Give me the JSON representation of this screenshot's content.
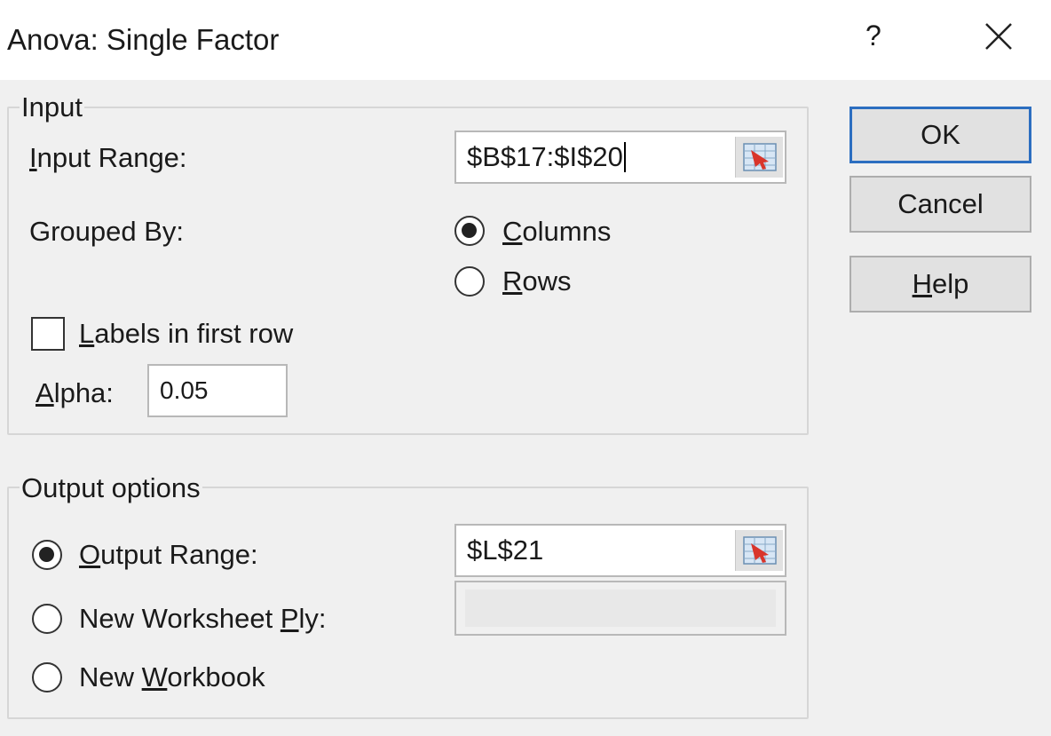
{
  "dialog": {
    "title": "Anova: Single Factor",
    "help_glyph": "?",
    "close_icon": "close-icon"
  },
  "input": {
    "legend": "Input",
    "input_range_label_first": "I",
    "input_range_label_rest": "nput Range:",
    "input_range_value": "$B$17:$I$20",
    "grouped_by_label": "Grouped By:",
    "columns_first": "C",
    "columns_rest": "olumns",
    "rows_first": "R",
    "rows_rest": "ows",
    "grouped_by_selected": "Columns",
    "labels_first": "L",
    "labels_rest": "abels in first row",
    "labels_checked": false,
    "alpha_first": "A",
    "alpha_rest": "lpha:",
    "alpha_value": "0.05"
  },
  "output": {
    "legend": "Output options",
    "output_range_first": "O",
    "output_range_rest": "utput Range:",
    "output_range_value": "$L$21",
    "new_ply_before": "New Worksheet ",
    "new_ply_u": "P",
    "new_ply_after": "ly:",
    "new_workbook_before": "New ",
    "new_workbook_u": "W",
    "new_workbook_after": "orkbook",
    "selected": "Output Range"
  },
  "buttons": {
    "ok": "OK",
    "cancel": "Cancel",
    "help_u": "H",
    "help_rest": "elp"
  },
  "colors": {
    "default_button_border": "#2c6ec0",
    "dialog_background": "#f0f0f0"
  }
}
